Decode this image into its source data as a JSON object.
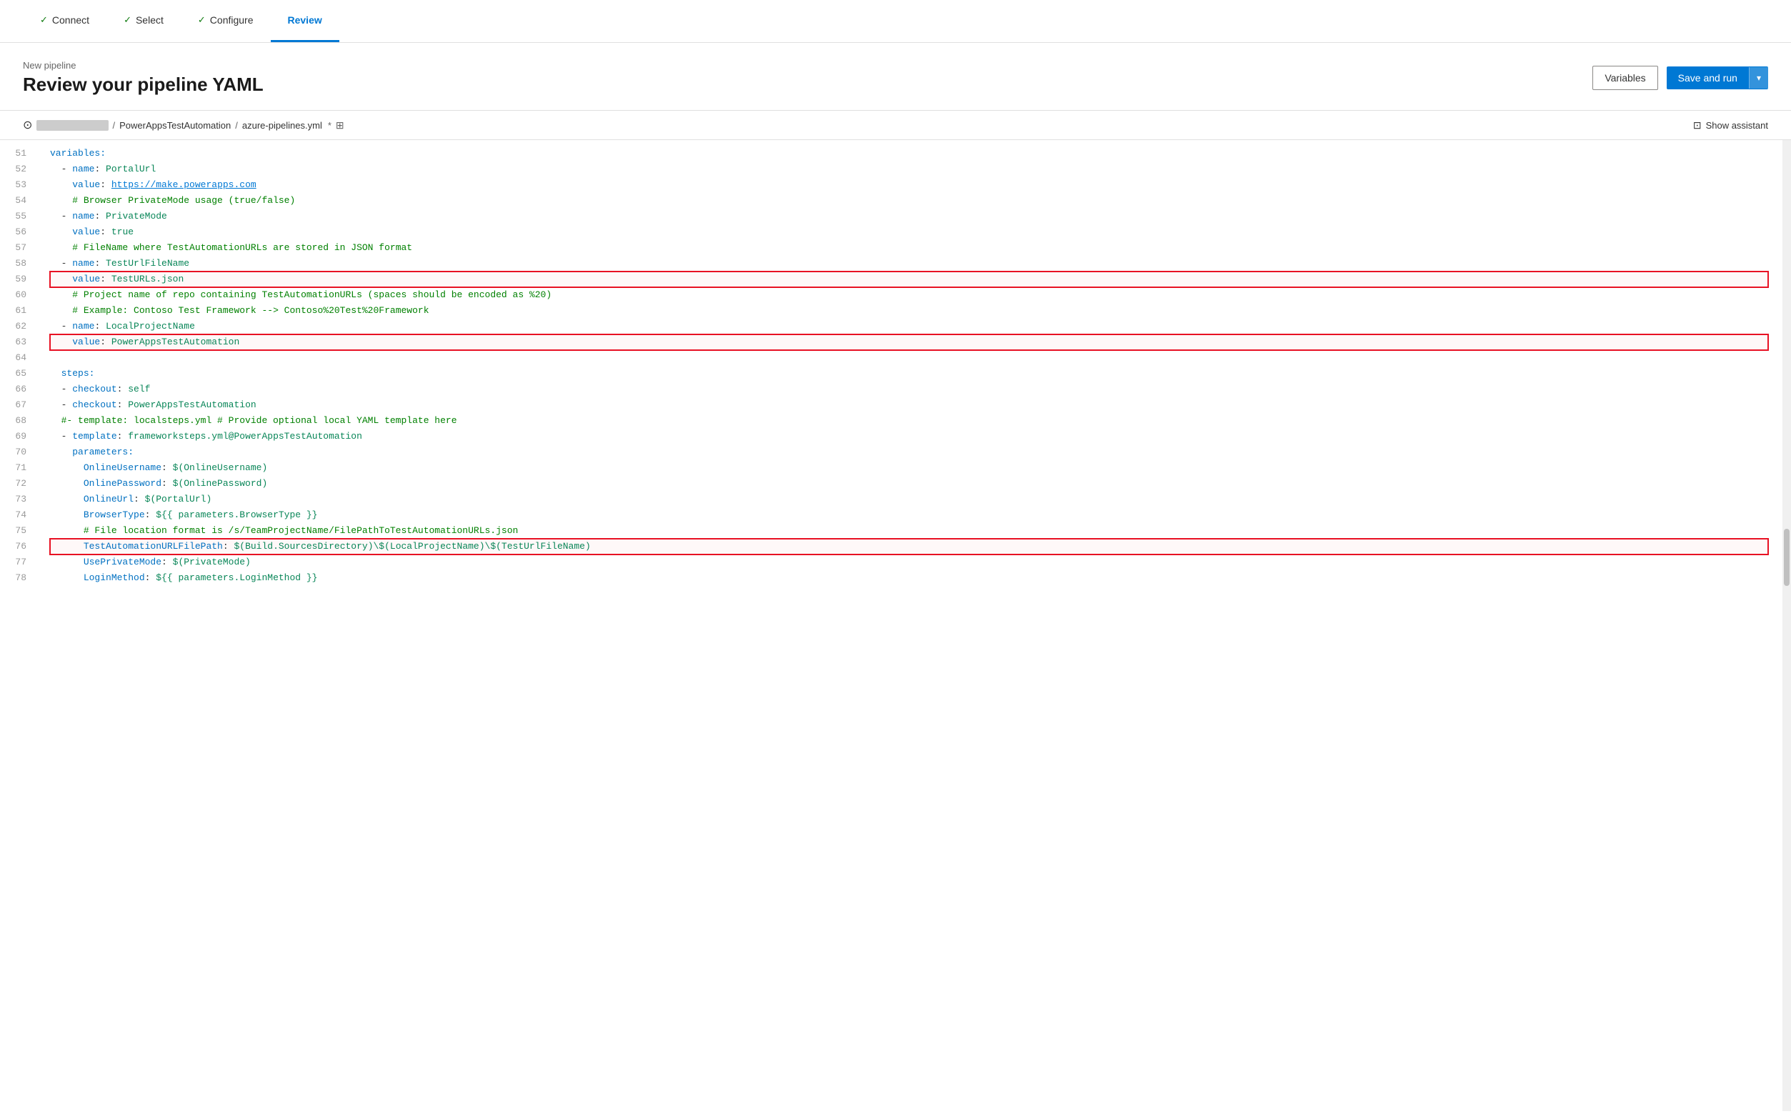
{
  "nav": {
    "steps": [
      {
        "id": "connect",
        "label": "Connect",
        "state": "completed"
      },
      {
        "id": "select",
        "label": "Select",
        "state": "completed"
      },
      {
        "id": "configure",
        "label": "Configure",
        "state": "completed"
      },
      {
        "id": "review",
        "label": "Review",
        "state": "active"
      }
    ]
  },
  "header": {
    "subtitle": "New pipeline",
    "title": "Review your pipeline YAML",
    "variables_label": "Variables",
    "save_run_label": "Save and run",
    "dropdown_icon": "▾"
  },
  "filebar": {
    "repo_name": "██████████",
    "slash": "/",
    "project": "PowerAppsTestAutomation",
    "separator": " / ",
    "filename": "azure-pipelines.yml",
    "modified": "*",
    "show_assistant": "Show assistant"
  },
  "code": {
    "lines": [
      {
        "num": 51,
        "text": "variables:",
        "highlighted": false,
        "parts": [
          {
            "cls": "c-key",
            "t": "variables:"
          }
        ]
      },
      {
        "num": 52,
        "text": "  - name: PortalUrl",
        "highlighted": false,
        "parts": [
          {
            "cls": "",
            "t": "  "
          },
          {
            "cls": "c-dash",
            "t": "- "
          },
          {
            "cls": "c-key",
            "t": "name"
          },
          {
            "cls": "",
            "t": ": "
          },
          {
            "cls": "c-val",
            "t": "PortalUrl"
          }
        ]
      },
      {
        "num": 53,
        "text": "    value: https://make.powerapps.com",
        "highlighted": false,
        "parts": [
          {
            "cls": "",
            "t": "    "
          },
          {
            "cls": "c-key",
            "t": "value"
          },
          {
            "cls": "",
            "t": ": "
          },
          {
            "cls": "c-url",
            "t": "https://make.powerapps.com"
          }
        ]
      },
      {
        "num": 54,
        "text": "    # Browser PrivateMode usage (true/false)",
        "highlighted": false,
        "parts": [
          {
            "cls": "",
            "t": "    "
          },
          {
            "cls": "c-comment",
            "t": "# Browser PrivateMode usage (true/false)"
          }
        ]
      },
      {
        "num": 55,
        "text": "  - name: PrivateMode",
        "highlighted": false,
        "parts": [
          {
            "cls": "",
            "t": "  "
          },
          {
            "cls": "c-dash",
            "t": "- "
          },
          {
            "cls": "c-key",
            "t": "name"
          },
          {
            "cls": "",
            "t": ": "
          },
          {
            "cls": "c-val",
            "t": "PrivateMode"
          }
        ]
      },
      {
        "num": 56,
        "text": "    value: true",
        "highlighted": false,
        "parts": [
          {
            "cls": "",
            "t": "    "
          },
          {
            "cls": "c-key",
            "t": "value"
          },
          {
            "cls": "",
            "t": ": "
          },
          {
            "cls": "c-val",
            "t": "true"
          }
        ]
      },
      {
        "num": 57,
        "text": "    # FileName where TestAutomationURLs are stored in JSON format",
        "highlighted": false,
        "parts": [
          {
            "cls": "",
            "t": "    "
          },
          {
            "cls": "c-comment",
            "t": "# FileName where TestAutomationURLs are stored in JSON format"
          }
        ]
      },
      {
        "num": 58,
        "text": "  - name: TestUrlFileName",
        "highlighted": false,
        "parts": [
          {
            "cls": "",
            "t": "  "
          },
          {
            "cls": "c-dash",
            "t": "- "
          },
          {
            "cls": "c-key",
            "t": "name"
          },
          {
            "cls": "",
            "t": ": "
          },
          {
            "cls": "c-val",
            "t": "TestUrlFileName"
          }
        ]
      },
      {
        "num": 59,
        "text": "    value: TestURLs.json",
        "highlighted": true,
        "parts": [
          {
            "cls": "",
            "t": "    "
          },
          {
            "cls": "c-key",
            "t": "value"
          },
          {
            "cls": "",
            "t": ": "
          },
          {
            "cls": "c-val",
            "t": "TestURLs.json"
          }
        ]
      },
      {
        "num": 60,
        "text": "    # Project name of repo containing TestAutomationURLs (spaces should be encoded as %20)",
        "highlighted": false,
        "parts": [
          {
            "cls": "",
            "t": "    "
          },
          {
            "cls": "c-comment",
            "t": "# Project name of repo containing TestAutomationURLs (spaces should be encoded as %20)"
          }
        ]
      },
      {
        "num": 61,
        "text": "    # Example: Contoso Test Framework --> Contoso%20Test%20Framework",
        "highlighted": false,
        "parts": [
          {
            "cls": "",
            "t": "    "
          },
          {
            "cls": "c-comment",
            "t": "# Example: Contoso Test Framework --> Contoso%20Test%20Framework"
          }
        ]
      },
      {
        "num": 62,
        "text": "  - name: LocalProjectName",
        "highlighted": false,
        "parts": [
          {
            "cls": "",
            "t": "  "
          },
          {
            "cls": "c-dash",
            "t": "- "
          },
          {
            "cls": "c-key",
            "t": "name"
          },
          {
            "cls": "",
            "t": ": "
          },
          {
            "cls": "c-val",
            "t": "LocalProjectName"
          }
        ]
      },
      {
        "num": 63,
        "text": "    value: PowerAppsTestAutomation",
        "highlighted": true,
        "parts": [
          {
            "cls": "",
            "t": "    "
          },
          {
            "cls": "c-key",
            "t": "value"
          },
          {
            "cls": "",
            "t": ": "
          },
          {
            "cls": "c-val",
            "t": "PowerAppsTestAutomation"
          }
        ]
      },
      {
        "num": 64,
        "text": "",
        "highlighted": false,
        "parts": []
      },
      {
        "num": 65,
        "text": "  steps:",
        "highlighted": false,
        "parts": [
          {
            "cls": "",
            "t": "  "
          },
          {
            "cls": "c-key",
            "t": "steps:"
          }
        ]
      },
      {
        "num": 66,
        "text": "  - checkout: self",
        "highlighted": false,
        "parts": [
          {
            "cls": "",
            "t": "  "
          },
          {
            "cls": "c-dash",
            "t": "- "
          },
          {
            "cls": "c-key",
            "t": "checkout"
          },
          {
            "cls": "",
            "t": ": "
          },
          {
            "cls": "c-val",
            "t": "self"
          }
        ]
      },
      {
        "num": 67,
        "text": "  - checkout: PowerAppsTestAutomation",
        "highlighted": false,
        "parts": [
          {
            "cls": "",
            "t": "  "
          },
          {
            "cls": "c-dash",
            "t": "- "
          },
          {
            "cls": "c-key",
            "t": "checkout"
          },
          {
            "cls": "",
            "t": ": "
          },
          {
            "cls": "c-val",
            "t": "PowerAppsTestAutomation"
          }
        ]
      },
      {
        "num": 68,
        "text": "  #- template: localsteps.yml # Provide optional local YAML template here",
        "highlighted": false,
        "parts": [
          {
            "cls": "",
            "t": "  "
          },
          {
            "cls": "c-comment",
            "t": "#- template: localsteps.yml # Provide optional local YAML template here"
          }
        ]
      },
      {
        "num": 69,
        "text": "  - template: frameworksteps.yml@PowerAppsTestAutomation",
        "highlighted": false,
        "parts": [
          {
            "cls": "",
            "t": "  "
          },
          {
            "cls": "c-dash",
            "t": "- "
          },
          {
            "cls": "c-key",
            "t": "template"
          },
          {
            "cls": "",
            "t": ": "
          },
          {
            "cls": "c-val",
            "t": "frameworksteps.yml@PowerAppsTestAutomation"
          }
        ]
      },
      {
        "num": 70,
        "text": "    parameters:",
        "highlighted": false,
        "parts": [
          {
            "cls": "",
            "t": "    "
          },
          {
            "cls": "c-key",
            "t": "parameters:"
          }
        ]
      },
      {
        "num": 71,
        "text": "      OnlineUsername: $(OnlineUsername)",
        "highlighted": false,
        "parts": [
          {
            "cls": "",
            "t": "      "
          },
          {
            "cls": "c-key",
            "t": "OnlineUsername"
          },
          {
            "cls": "",
            "t": ": "
          },
          {
            "cls": "c-val",
            "t": "$(OnlineUsername)"
          }
        ]
      },
      {
        "num": 72,
        "text": "      OnlinePassword: $(OnlinePassword)",
        "highlighted": false,
        "parts": [
          {
            "cls": "",
            "t": "      "
          },
          {
            "cls": "c-key",
            "t": "OnlinePassword"
          },
          {
            "cls": "",
            "t": ": "
          },
          {
            "cls": "c-val",
            "t": "$(OnlinePassword)"
          }
        ]
      },
      {
        "num": 73,
        "text": "      OnlineUrl: $(PortalUrl)",
        "highlighted": false,
        "parts": [
          {
            "cls": "",
            "t": "      "
          },
          {
            "cls": "c-key",
            "t": "OnlineUrl"
          },
          {
            "cls": "",
            "t": ": "
          },
          {
            "cls": "c-val",
            "t": "$(PortalUrl)"
          }
        ]
      },
      {
        "num": 74,
        "text": "      BrowserType: ${{ parameters.BrowserType }}",
        "highlighted": false,
        "parts": [
          {
            "cls": "",
            "t": "      "
          },
          {
            "cls": "c-key",
            "t": "BrowserType"
          },
          {
            "cls": "",
            "t": ": "
          },
          {
            "cls": "c-val",
            "t": "${{ parameters.BrowserType }}"
          }
        ]
      },
      {
        "num": 75,
        "text": "      # File location format is /s/TeamProjectName/FilePathToTestAutomationURLs.json",
        "highlighted": false,
        "parts": [
          {
            "cls": "",
            "t": "      "
          },
          {
            "cls": "c-comment",
            "t": "# File location format is /s/TeamProjectName/FilePathToTestAutomationURLs.json"
          }
        ]
      },
      {
        "num": 76,
        "text": "      TestAutomationURLFilePath: $(Build.SourcesDirectory)\\$(LocalProjectName)\\$(TestUrlFileName)",
        "highlighted": true,
        "parts": [
          {
            "cls": "",
            "t": "      "
          },
          {
            "cls": "c-key",
            "t": "TestAutomationURLFilePath"
          },
          {
            "cls": "",
            "t": ": "
          },
          {
            "cls": "c-val",
            "t": "$(Build.SourcesDirectory)\\$(LocalProjectName)\\$(TestUrlFileName)"
          }
        ]
      },
      {
        "num": 77,
        "text": "      UsePrivateMode: $(PrivateMode)",
        "highlighted": false,
        "parts": [
          {
            "cls": "",
            "t": "      "
          },
          {
            "cls": "c-key",
            "t": "UsePrivateMode"
          },
          {
            "cls": "",
            "t": ": "
          },
          {
            "cls": "c-val",
            "t": "$(PrivateMode)"
          }
        ]
      },
      {
        "num": 78,
        "text": "      LoginMethod: ${{ parameters.LoginMethod }}",
        "highlighted": false,
        "parts": [
          {
            "cls": "",
            "t": "      "
          },
          {
            "cls": "c-key",
            "t": "LoginMethod"
          },
          {
            "cls": "",
            "t": ": "
          },
          {
            "cls": "c-val",
            "t": "${{ parameters.LoginMethod }}"
          }
        ]
      }
    ]
  }
}
